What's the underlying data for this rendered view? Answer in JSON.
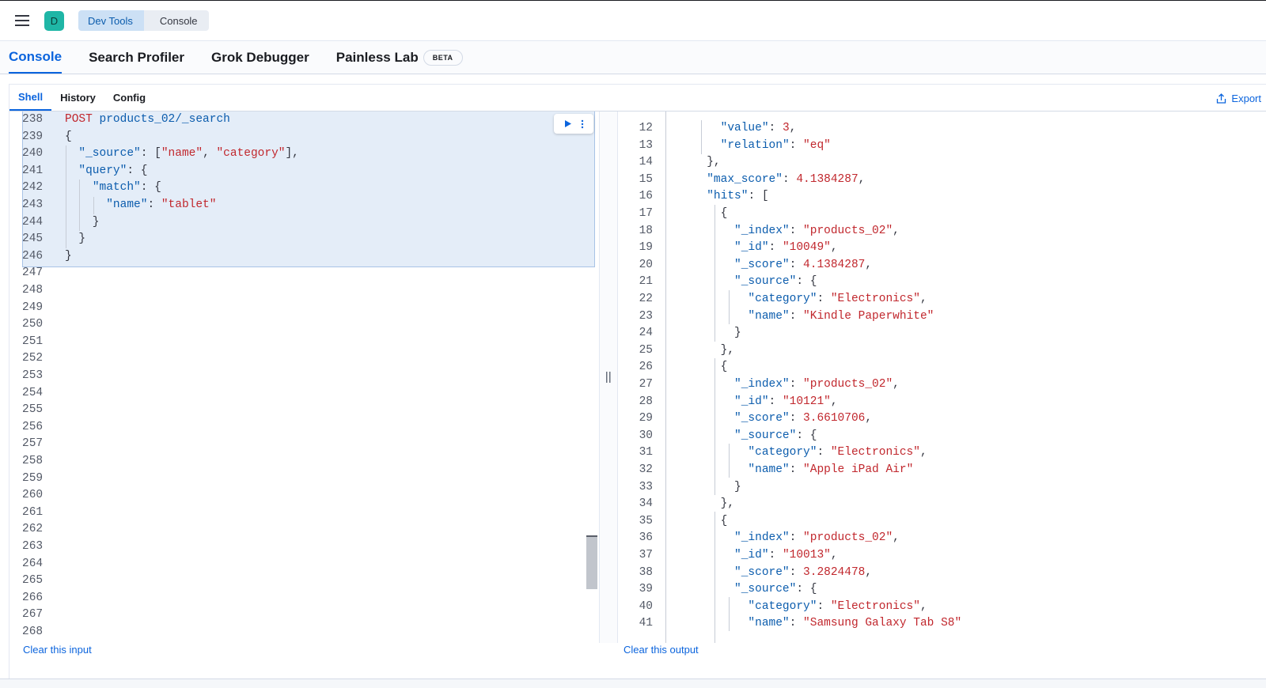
{
  "breadcrumbs": [
    "Dev Tools",
    "Console"
  ],
  "app_logo_letter": "D",
  "tabs": [
    {
      "label": "Console",
      "active": true
    },
    {
      "label": "Search Profiler",
      "active": false
    },
    {
      "label": "Grok Debugger",
      "active": false
    },
    {
      "label": "Painless Lab",
      "active": false,
      "badge": "BETA"
    }
  ],
  "subtabs": [
    {
      "label": "Shell",
      "active": true
    },
    {
      "label": "History",
      "active": false
    },
    {
      "label": "Config",
      "active": false
    }
  ],
  "export_label": "Export",
  "input": {
    "lines": [
      {
        "n": "238",
        "tokens": [
          [
            "kw",
            "POST"
          ],
          [
            "p",
            " "
          ],
          [
            "url",
            "products_02/_search"
          ]
        ]
      },
      {
        "n": "239",
        "tokens": [
          [
            "p",
            "{"
          ]
        ]
      },
      {
        "n": "240",
        "tokens": [
          [
            "p",
            "  "
          ],
          [
            "key",
            "\"_source\""
          ],
          [
            "p",
            ": ["
          ],
          [
            "str",
            "\"name\""
          ],
          [
            "p",
            ", "
          ],
          [
            "str",
            "\"category\""
          ],
          [
            "p",
            "],"
          ]
        ]
      },
      {
        "n": "241",
        "tokens": [
          [
            "p",
            "  "
          ],
          [
            "key",
            "\"query\""
          ],
          [
            "p",
            ": {"
          ]
        ]
      },
      {
        "n": "242",
        "tokens": [
          [
            "p",
            "    "
          ],
          [
            "key",
            "\"match\""
          ],
          [
            "p",
            ": {"
          ]
        ]
      },
      {
        "n": "243",
        "tokens": [
          [
            "p",
            "      "
          ],
          [
            "key",
            "\"name\""
          ],
          [
            "p",
            ": "
          ],
          [
            "str",
            "\"tablet\""
          ]
        ]
      },
      {
        "n": "244",
        "tokens": [
          [
            "p",
            "    }"
          ]
        ]
      },
      {
        "n": "245",
        "tokens": [
          [
            "p",
            "  }"
          ]
        ]
      },
      {
        "n": "246",
        "tokens": [
          [
            "p",
            "}"
          ]
        ]
      },
      {
        "n": "247",
        "tokens": []
      },
      {
        "n": "248",
        "tokens": []
      },
      {
        "n": "249",
        "tokens": []
      },
      {
        "n": "250",
        "tokens": []
      },
      {
        "n": "251",
        "tokens": []
      },
      {
        "n": "252",
        "tokens": []
      },
      {
        "n": "253",
        "tokens": []
      },
      {
        "n": "254",
        "tokens": []
      },
      {
        "n": "255",
        "tokens": []
      },
      {
        "n": "256",
        "tokens": []
      },
      {
        "n": "257",
        "tokens": []
      },
      {
        "n": "258",
        "tokens": []
      },
      {
        "n": "259",
        "tokens": []
      },
      {
        "n": "260",
        "tokens": []
      },
      {
        "n": "261",
        "tokens": []
      },
      {
        "n": "262",
        "tokens": []
      },
      {
        "n": "263",
        "tokens": []
      },
      {
        "n": "264",
        "tokens": []
      },
      {
        "n": "265",
        "tokens": []
      },
      {
        "n": "266",
        "tokens": []
      },
      {
        "n": "267",
        "tokens": []
      },
      {
        "n": "268",
        "tokens": []
      }
    ]
  },
  "output": {
    "lines": [
      {
        "n": "12",
        "tokens": [
          [
            "p",
            "        "
          ],
          [
            "key",
            "\"value\""
          ],
          [
            "p",
            ": "
          ],
          [
            "num",
            "3"
          ],
          [
            "p",
            ","
          ]
        ]
      },
      {
        "n": "13",
        "tokens": [
          [
            "p",
            "        "
          ],
          [
            "key",
            "\"relation\""
          ],
          [
            "p",
            ": "
          ],
          [
            "str",
            "\"eq\""
          ]
        ]
      },
      {
        "n": "14",
        "tokens": [
          [
            "p",
            "      },"
          ]
        ]
      },
      {
        "n": "15",
        "tokens": [
          [
            "p",
            "      "
          ],
          [
            "key",
            "\"max_score\""
          ],
          [
            "p",
            ": "
          ],
          [
            "num",
            "4.1384287"
          ],
          [
            "p",
            ","
          ]
        ]
      },
      {
        "n": "16",
        "tokens": [
          [
            "p",
            "      "
          ],
          [
            "key",
            "\"hits\""
          ],
          [
            "p",
            ": ["
          ]
        ]
      },
      {
        "n": "17",
        "tokens": [
          [
            "p",
            "        {"
          ]
        ]
      },
      {
        "n": "18",
        "tokens": [
          [
            "p",
            "          "
          ],
          [
            "key",
            "\"_index\""
          ],
          [
            "p",
            ": "
          ],
          [
            "str",
            "\"products_02\""
          ],
          [
            "p",
            ","
          ]
        ]
      },
      {
        "n": "19",
        "tokens": [
          [
            "p",
            "          "
          ],
          [
            "key",
            "\"_id\""
          ],
          [
            "p",
            ": "
          ],
          [
            "str",
            "\"10049\""
          ],
          [
            "p",
            ","
          ]
        ]
      },
      {
        "n": "20",
        "tokens": [
          [
            "p",
            "          "
          ],
          [
            "key",
            "\"_score\""
          ],
          [
            "p",
            ": "
          ],
          [
            "num",
            "4.1384287"
          ],
          [
            "p",
            ","
          ]
        ]
      },
      {
        "n": "21",
        "tokens": [
          [
            "p",
            "          "
          ],
          [
            "key",
            "\"_source\""
          ],
          [
            "p",
            ": {"
          ]
        ]
      },
      {
        "n": "22",
        "tokens": [
          [
            "p",
            "            "
          ],
          [
            "key",
            "\"category\""
          ],
          [
            "p",
            ": "
          ],
          [
            "str",
            "\"Electronics\""
          ],
          [
            "p",
            ","
          ]
        ]
      },
      {
        "n": "23",
        "tokens": [
          [
            "p",
            "            "
          ],
          [
            "key",
            "\"name\""
          ],
          [
            "p",
            ": "
          ],
          [
            "str",
            "\"Kindle Paperwhite\""
          ]
        ]
      },
      {
        "n": "24",
        "tokens": [
          [
            "p",
            "          }"
          ]
        ]
      },
      {
        "n": "25",
        "tokens": [
          [
            "p",
            "        },"
          ]
        ]
      },
      {
        "n": "26",
        "tokens": [
          [
            "p",
            "        {"
          ]
        ]
      },
      {
        "n": "27",
        "tokens": [
          [
            "p",
            "          "
          ],
          [
            "key",
            "\"_index\""
          ],
          [
            "p",
            ": "
          ],
          [
            "str",
            "\"products_02\""
          ],
          [
            "p",
            ","
          ]
        ]
      },
      {
        "n": "28",
        "tokens": [
          [
            "p",
            "          "
          ],
          [
            "key",
            "\"_id\""
          ],
          [
            "p",
            ": "
          ],
          [
            "str",
            "\"10121\""
          ],
          [
            "p",
            ","
          ]
        ]
      },
      {
        "n": "29",
        "tokens": [
          [
            "p",
            "          "
          ],
          [
            "key",
            "\"_score\""
          ],
          [
            "p",
            ": "
          ],
          [
            "num",
            "3.6610706"
          ],
          [
            "p",
            ","
          ]
        ]
      },
      {
        "n": "30",
        "tokens": [
          [
            "p",
            "          "
          ],
          [
            "key",
            "\"_source\""
          ],
          [
            "p",
            ": {"
          ]
        ]
      },
      {
        "n": "31",
        "tokens": [
          [
            "p",
            "            "
          ],
          [
            "key",
            "\"category\""
          ],
          [
            "p",
            ": "
          ],
          [
            "str",
            "\"Electronics\""
          ],
          [
            "p",
            ","
          ]
        ]
      },
      {
        "n": "32",
        "tokens": [
          [
            "p",
            "            "
          ],
          [
            "key",
            "\"name\""
          ],
          [
            "p",
            ": "
          ],
          [
            "str",
            "\"Apple iPad Air\""
          ]
        ]
      },
      {
        "n": "33",
        "tokens": [
          [
            "p",
            "          }"
          ]
        ]
      },
      {
        "n": "34",
        "tokens": [
          [
            "p",
            "        },"
          ]
        ]
      },
      {
        "n": "35",
        "tokens": [
          [
            "p",
            "        {"
          ]
        ]
      },
      {
        "n": "36",
        "tokens": [
          [
            "p",
            "          "
          ],
          [
            "key",
            "\"_index\""
          ],
          [
            "p",
            ": "
          ],
          [
            "str",
            "\"products_02\""
          ],
          [
            "p",
            ","
          ]
        ]
      },
      {
        "n": "37",
        "tokens": [
          [
            "p",
            "          "
          ],
          [
            "key",
            "\"_id\""
          ],
          [
            "p",
            ": "
          ],
          [
            "str",
            "\"10013\""
          ],
          [
            "p",
            ","
          ]
        ]
      },
      {
        "n": "38",
        "tokens": [
          [
            "p",
            "          "
          ],
          [
            "key",
            "\"_score\""
          ],
          [
            "p",
            ": "
          ],
          [
            "num",
            "3.2824478"
          ],
          [
            "p",
            ","
          ]
        ]
      },
      {
        "n": "39",
        "tokens": [
          [
            "p",
            "          "
          ],
          [
            "key",
            "\"_source\""
          ],
          [
            "p",
            ": {"
          ]
        ]
      },
      {
        "n": "40",
        "tokens": [
          [
            "p",
            "            "
          ],
          [
            "key",
            "\"category\""
          ],
          [
            "p",
            ": "
          ],
          [
            "str",
            "\"Electronics\""
          ],
          [
            "p",
            ","
          ]
        ]
      },
      {
        "n": "41",
        "tokens": [
          [
            "p",
            "            "
          ],
          [
            "key",
            "\"name\""
          ],
          [
            "p",
            ": "
          ],
          [
            "str",
            "\"Samsung Galaxy Tab S8\""
          ]
        ]
      }
    ]
  },
  "footer": {
    "clear_input": "Clear this input",
    "clear_output": "Clear this output"
  },
  "colors": {
    "accent": "#0b64dd",
    "string": "#c1272d",
    "key": "#0b5cad",
    "selection": "#e4edf8"
  }
}
